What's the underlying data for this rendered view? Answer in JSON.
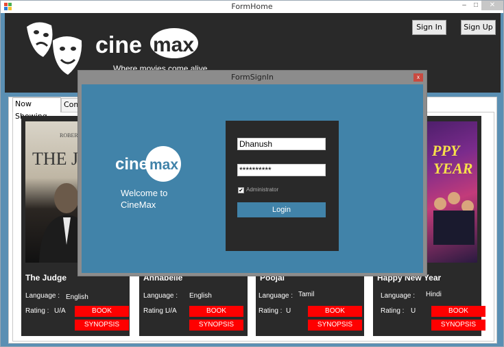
{
  "window": {
    "title": "FormHome",
    "min_label": "–",
    "max_label": "□",
    "close_label": "✕"
  },
  "header": {
    "logo_left": "cine",
    "logo_right": "max",
    "tagline": "Where movies come alive",
    "signin_label": "Sign In",
    "signup_label": "Sign Up"
  },
  "tabs": [
    {
      "label": "Now Showing"
    },
    {
      "label": "Coming Soon"
    }
  ],
  "movies": [
    {
      "title": "The Judge",
      "language_label": "Language :",
      "language": "English",
      "rating_label": "Rating :",
      "rating": "U/A",
      "book_label": "BOOK",
      "synopsis_label": "SYNOPSIS",
      "poster_text": "THE JU",
      "poster_text2": "ROBER"
    },
    {
      "title": "Annabelle",
      "language_label": "Language :",
      "language": "English",
      "rating_label": "Rating :",
      "rating": "U/A",
      "book_label": "BOOK",
      "synopsis_label": "SYNOPSIS"
    },
    {
      "title": "Poojai",
      "language_label": "Language :",
      "language": "Tamil",
      "rating_label": "Rating :",
      "rating": "U",
      "book_label": "BOOK",
      "synopsis_label": "SYNOPSIS"
    },
    {
      "title": "Happy New Year",
      "language_label": "Language :",
      "language": "Hindi",
      "rating_label": "Rating :",
      "rating": "U",
      "book_label": "BOOK",
      "synopsis_label": "SYNOPSIS",
      "poster_text": "PPY",
      "poster_text2": "YEAR"
    }
  ],
  "dialog": {
    "title": "FormSignIn",
    "close_label": "x",
    "logo_left": "cine",
    "logo_right": "max",
    "welcome": "Welcome to CineMax",
    "username_value": "Dhanush",
    "password_value": "**********",
    "admin_checked": "✔",
    "admin_label": "Administrator",
    "login_label": "Login"
  },
  "colors": {
    "header_bg": "#292929",
    "accent_blue": "#4183a9",
    "button_red": "#ff0000"
  }
}
